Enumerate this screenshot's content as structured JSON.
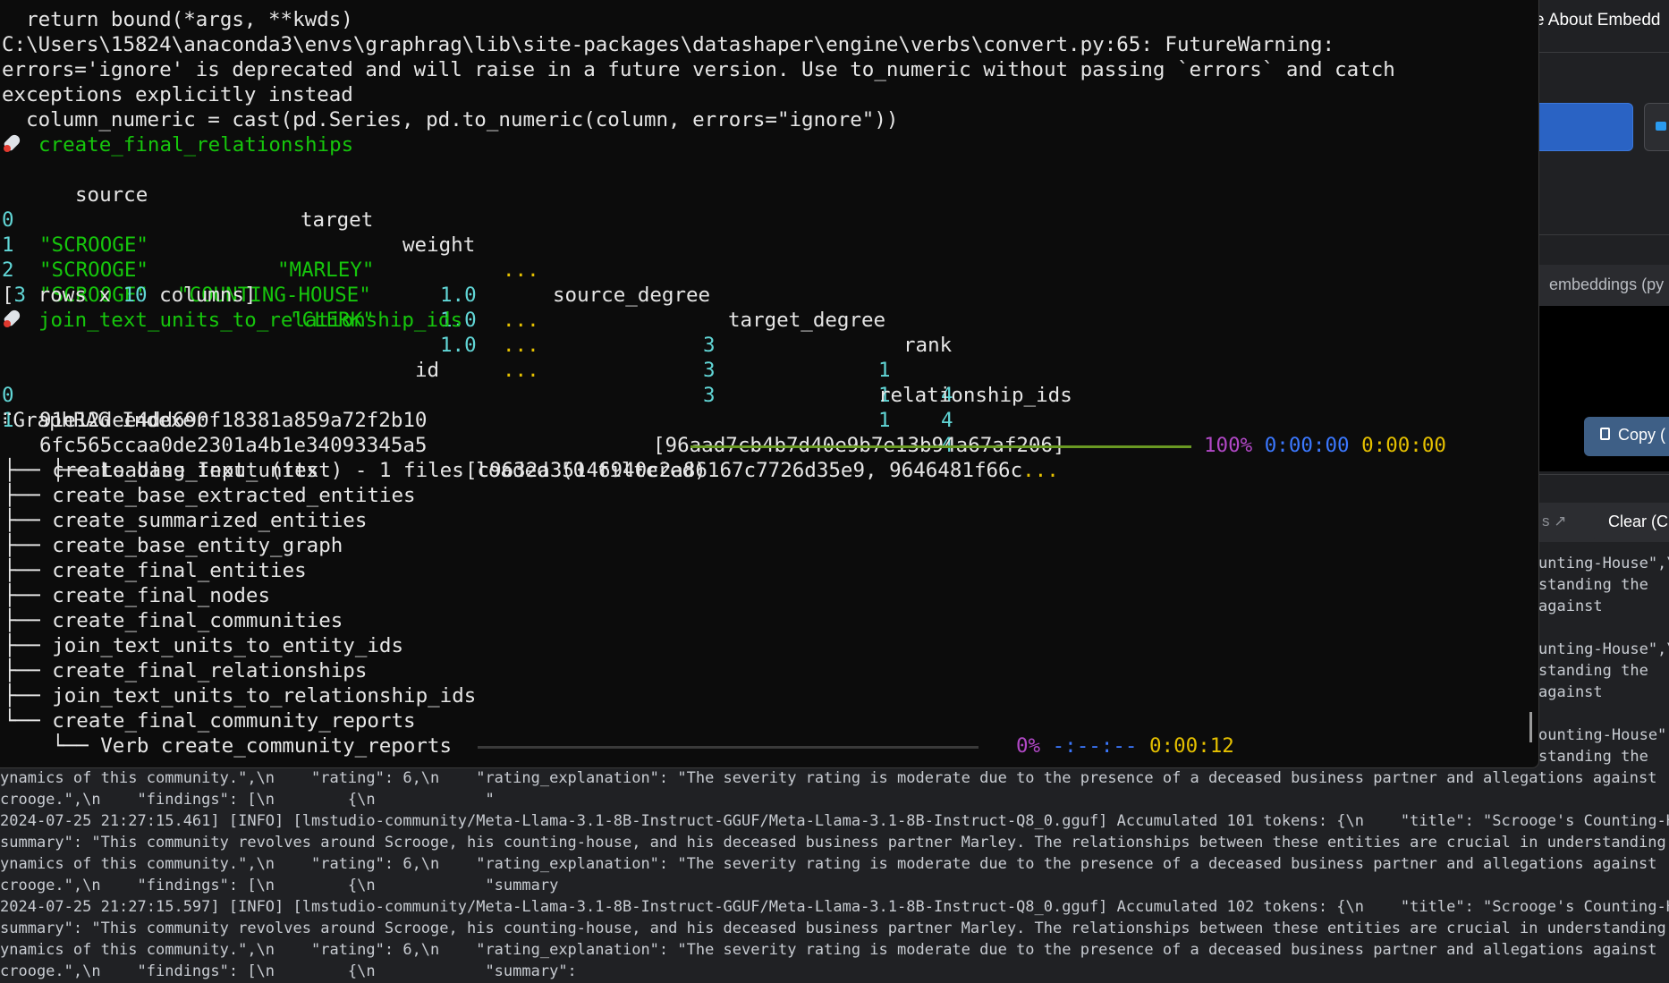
{
  "background_app": {
    "title_fragment": "e About Embedd",
    "panel_header_fragment": "embeddings (py",
    "copy_button": "Copy (",
    "button_fragment": "s ↗",
    "clear_button": "Clear (C",
    "accent_color": "#2a63c4"
  },
  "terminal": {
    "lines": {
      "l1": "  return bound(*args, **kwds)",
      "l2": "C:\\Users\\15824\\anaconda3\\envs\\graphrag\\lib\\site-packages\\datashaper\\engine\\verbs\\convert.py:65: FutureWarning:",
      "l3": "errors='ignore' is deprecated and will raise in a future version. Use to_numeric without passing `errors` and catch",
      "l4": "exceptions explicitly instead",
      "l5": "  column_numeric = cast(pd.Series, pd.to_numeric(column, errors=\"ignore\"))"
    },
    "step1_name": "create_final_relationships",
    "rel_table": {
      "header": {
        "source": "source",
        "target": "target",
        "weight": "weight",
        "ellipsis": "...",
        "source_degree": "source_degree",
        "target_degree": "target_degree",
        "rank": "rank"
      },
      "rows": [
        {
          "idx": "0",
          "source": "\"SCROOGE\"",
          "target": "\"MARLEY\"",
          "weight": "1.0",
          "ellipsis": "...",
          "source_degree": "3",
          "target_degree": "1",
          "rank": "4"
        },
        {
          "idx": "1",
          "source": "\"SCROOGE\"",
          "target": "\"COUNTING-HOUSE\"",
          "weight": "1.0",
          "ellipsis": "...",
          "source_degree": "3",
          "target_degree": "1",
          "rank": "4"
        },
        {
          "idx": "2",
          "source": "\"SCROOGE\"",
          "target": "\"CLERK\"",
          "weight": "1.0",
          "ellipsis": "...",
          "source_degree": "3",
          "target_degree": "1",
          "rank": "4"
        }
      ],
      "summary": {
        "open": "[",
        "rows": "3",
        "mid": " rows x ",
        "cols": "10",
        "close": " columns]"
      }
    },
    "step2_name": "join_text_units_to_relationship_ids",
    "id_table": {
      "header_id": "id",
      "header_rel": "relationship_ids",
      "rows": [
        {
          "idx": "0",
          "id": "91e12dee4dd690f18381a859a72f2b10",
          "rel": "[96aad7cb4b7d40e9b7e13b94a67af206]",
          "rel_ellipsis": ""
        },
        {
          "idx": "1",
          "id": "6fc565ccaa0de2301a4b1e34093345a5",
          "rel": "[c9632a35146940c2a86167c7726d35e9, 9646481f66c",
          "rel_ellipsis": "..."
        }
      ]
    },
    "indexer": {
      "title": "GraphRAG Indexer",
      "loading_label": "Loading Input (text) - 1 files loaded (0 filtered)",
      "loading_progress": 1.0,
      "loading_percent": "100%",
      "loading_elapsed": "0:00:00",
      "loading_remaining": "0:00:00",
      "steps": [
        "create_base_text_units",
        "create_base_extracted_entities",
        "create_summarized_entities",
        "create_base_entity_graph",
        "create_final_entities",
        "create_final_nodes",
        "create_final_communities",
        "join_text_units_to_entity_ids",
        "create_final_relationships",
        "join_text_units_to_relationship_ids",
        "create_final_community_reports"
      ],
      "verb_label": "Verb create_community_reports",
      "verb_progress": 0.0,
      "verb_percent": "0%",
      "verb_eta": "-:--:--",
      "verb_elapsed": "0:00:12"
    },
    "colors": {
      "green": "#16c60c",
      "yellow": "#e5c000",
      "cyan": "#61d6d6",
      "magenta": "#b148c6",
      "blue": "#3b78ff",
      "bar_done": "#6a9a23",
      "bar_pending": "#3a3a3a"
    }
  },
  "log": {
    "right_lines": [
      "unting-House\",\\",
      "standing the",
      "against",
      "unting-House\",\\",
      "standing the",
      "against",
      "ounting-House\",",
      "standing the"
    ],
    "bottom_lines": [
      "ynamics of this community.\",\\n    \"rating\": 6,\\n    \"rating_explanation\": \"The severity rating is moderate due to the presence of a deceased business partner and allegations against",
      "crooge.\",\\n    \"findings\": [\\n        {\\n            \"",
      "2024-07-25 21:27:15.461] [INFO] [lmstudio-community/Meta-Llama-3.1-8B-Instruct-GGUF/Meta-Llama-3.1-8B-Instruct-Q8_0.gguf] Accumulated 101 tokens: {\\n    \"title\": \"Scrooge's Counting-House\",",
      "summary\": \"This community revolves around Scrooge, his counting-house, and his deceased business partner Marley. The relationships between these entities are crucial in understanding the",
      "ynamics of this community.\",\\n    \"rating\": 6,\\n    \"rating_explanation\": \"The severity rating is moderate due to the presence of a deceased business partner and allegations against",
      "crooge.\",\\n    \"findings\": [\\n        {\\n            \"summary",
      "2024-07-25 21:27:15.597] [INFO] [lmstudio-community/Meta-Llama-3.1-8B-Instruct-GGUF/Meta-Llama-3.1-8B-Instruct-Q8_0.gguf] Accumulated 102 tokens: {\\n    \"title\": \"Scrooge's Counting-House\",",
      "summary\": \"This community revolves around Scrooge, his counting-house, and his deceased business partner Marley. The relationships between these entities are crucial in understanding the",
      "ynamics of this community.\",\\n    \"rating\": 6,\\n    \"rating_explanation\": \"The severity rating is moderate due to the presence of a deceased business partner and allegations against",
      "crooge.\",\\n    \"findings\": [\\n        {\\n            \"summary\":"
    ]
  }
}
